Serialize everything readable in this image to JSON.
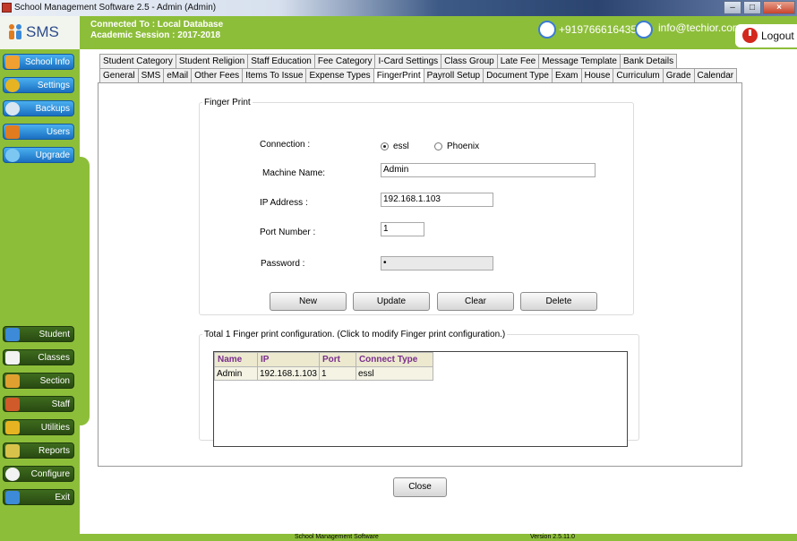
{
  "window": {
    "title": "School Management Software 2.5  - Admin (Admin)"
  },
  "header": {
    "app_name": "SMS",
    "connection": "Connected To : Local Database",
    "session": "Academic Session : 2017-2018",
    "phone": "+919766616435",
    "email": "info@techior.com",
    "logout": "Logout"
  },
  "sidebar": {
    "top_items": [
      "School Info",
      "Settings",
      "Backups",
      "Users",
      "Upgrade"
    ],
    "bottom_items": [
      "Student",
      "Classes",
      "Section",
      "Staff",
      "Utilities",
      "Reports",
      "Configure",
      "Exit"
    ]
  },
  "tabs": {
    "row1": [
      "Student Category",
      "Student Religion",
      "Staff Education",
      "Fee Category",
      "I-Card Settings",
      "Class Group",
      "Late Fee",
      "Message Template",
      "Bank Details"
    ],
    "row2": [
      "General",
      "SMS",
      "eMail",
      "Other Fees",
      "Items To Issue",
      "Expense Types",
      "FingerPrint",
      "Payroll Setup",
      "Document Type",
      "Exam",
      "House",
      "Curriculum",
      "Grade",
      "Calendar"
    ],
    "active": "FingerPrint"
  },
  "fingerprint": {
    "legend": "Finger Print",
    "connection_label": "Connection :",
    "option_essl": "essl",
    "option_phoenix": "Phoenix",
    "machine_label": "Machine Name:",
    "machine_value": "Admin",
    "ip_label": "IP Address :",
    "ip_value": "192.168.1.103",
    "port_label": "Port Number :",
    "port_value": "1",
    "password_label": "Password :",
    "password_value": "•",
    "buttons": {
      "new": "New",
      "update": "Update",
      "clear": "Clear",
      "delete": "Delete"
    }
  },
  "config_list": {
    "legend": "Total 1 Finger print configuration. (Click to modify Finger print configuration.)",
    "columns": [
      "Name",
      "IP",
      "Port",
      "Connect Type"
    ],
    "rows": [
      [
        "Admin",
        "192.168.1.103",
        "1",
        "essl"
      ]
    ]
  },
  "close_button": "Close",
  "footer": {
    "product": "School Management Software",
    "version": "Version 2.5.11.0"
  }
}
